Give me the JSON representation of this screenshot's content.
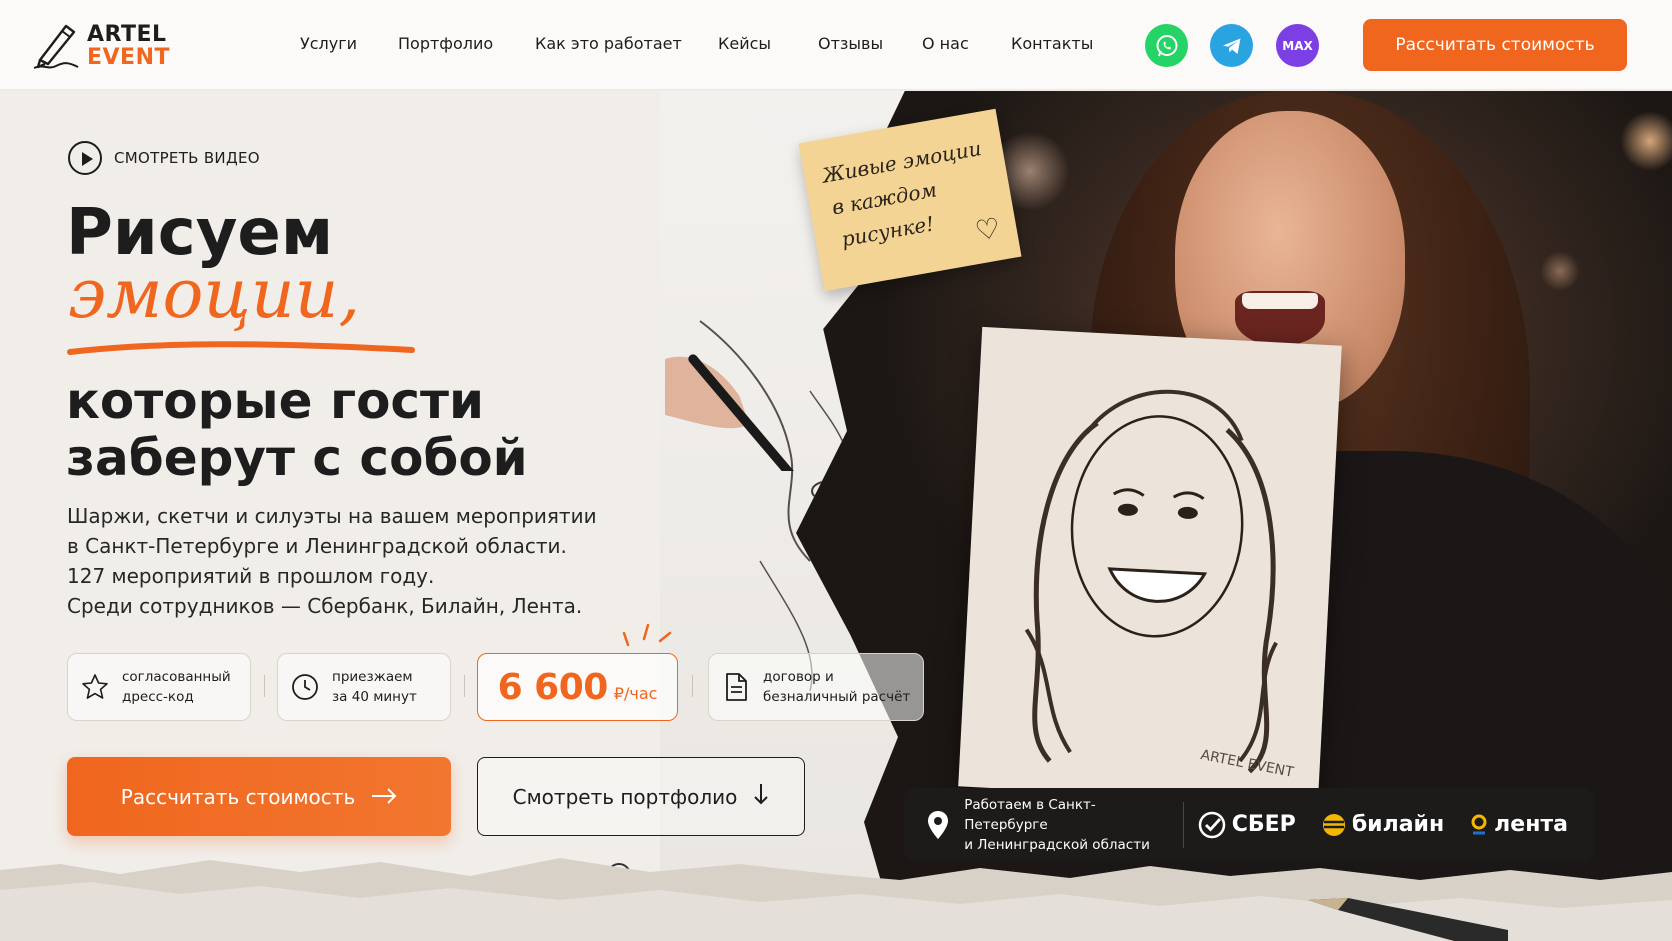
{
  "header": {
    "logo_line1": "ARTEL",
    "logo_line2": "EVENT",
    "nav": [
      "Услуги",
      "Портфолио",
      "Как это работает",
      "Кейсы",
      "Отзывы",
      "О нас",
      "Контакты"
    ],
    "social": {
      "max_label": "MAX"
    },
    "cta": "Рассчитать стоимость"
  },
  "colors": {
    "accent": "#f0661e",
    "dark": "#1d1d1d",
    "whatsapp": "#25d366",
    "telegram": "#2aa3e1",
    "max": "#7b3fe4"
  },
  "hero": {
    "watch_video": "СМОТРЕТЬ ВИДЕО",
    "title_line1": "Рисуем",
    "title_accent": "эмоции,",
    "title_line3": "которые гости",
    "title_line4": "заберут с собой",
    "lead": [
      "Шаржи, скетчи и силуэты на вашем мероприятии",
      "в Санкт-Петербурге и Ленинградской области.",
      "127 мероприятий в прошлом году.",
      "Среди сотрудников — Сбербанк, Билайн, Лента."
    ],
    "features": [
      {
        "icon": "star-icon",
        "line1": "согласованный",
        "line2": "дресс-код"
      },
      {
        "icon": "clock-icon",
        "line1": "приезжаем",
        "line2": "за 40 минут"
      },
      {
        "icon": "document-icon",
        "line1": "договор и",
        "line2": "безналичный расчёт"
      }
    ],
    "price_value": "6 600",
    "price_unit": "₽/час",
    "btn_calc": "Рассчитать стоимость",
    "btn_portfolio": "Смотреть портфолио"
  },
  "sticky_note": {
    "line1": "Живые эмоции",
    "line2": "в каждом",
    "line3": "рисунке!"
  },
  "clients_bar": {
    "line1": "Работаем в Санкт-Петербурге",
    "line2": "и Ленинградской области",
    "logos": [
      "СБЕР",
      "билайн",
      "лента"
    ]
  },
  "sketch_signature": "ARTEL EVENT"
}
